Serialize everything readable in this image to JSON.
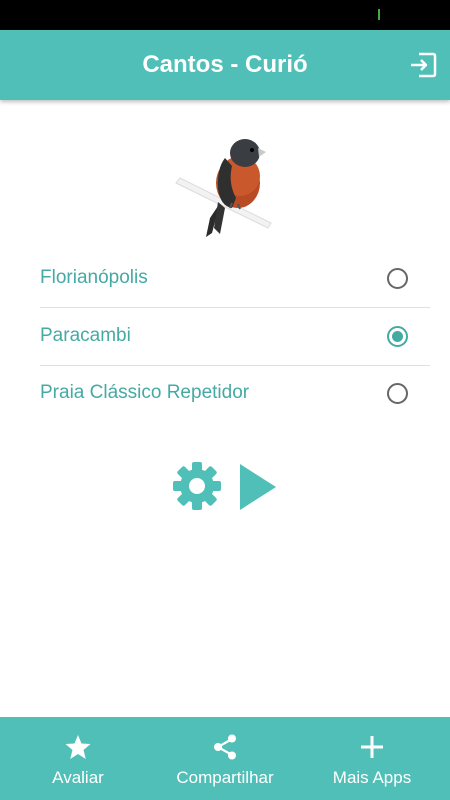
{
  "app_bar": {
    "title": "Cantos - Curió",
    "exit_icon": "exit-icon"
  },
  "image": {
    "name": "bird-image"
  },
  "songs": [
    {
      "label": "Florianópolis",
      "selected": false
    },
    {
      "label": "Paracambi",
      "selected": true
    },
    {
      "label": "Praia Clássico Repetidor",
      "selected": false
    }
  ],
  "controls": {
    "settings_icon": "gear-icon",
    "play_icon": "play-icon"
  },
  "bottom_nav": [
    {
      "label": "Avaliar",
      "icon": "star-icon"
    },
    {
      "label": "Compartilhar",
      "icon": "share-icon"
    },
    {
      "label": "Mais Apps",
      "icon": "plus-icon"
    }
  ],
  "colors": {
    "accent": "#4fbfb8",
    "text_accent": "#45aaa4"
  }
}
